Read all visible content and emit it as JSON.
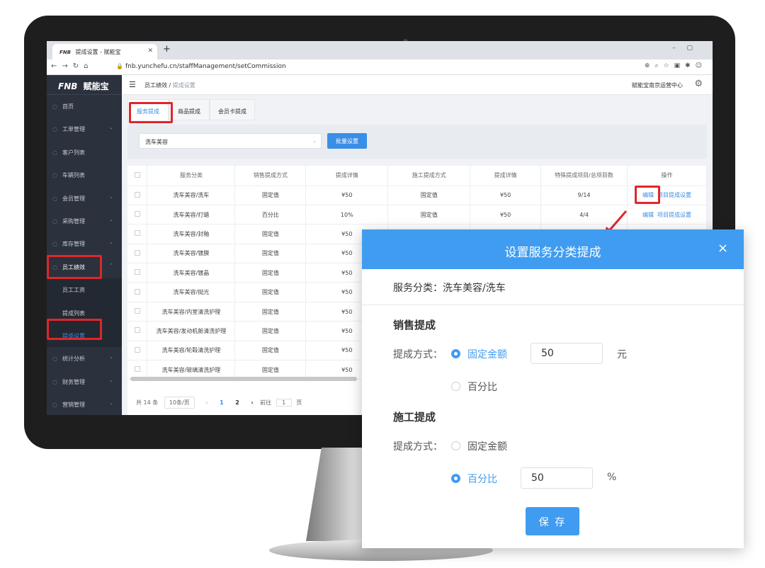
{
  "browser": {
    "tab_title": "提成设置 - 赋能宝",
    "tab_logo": "FNB",
    "url": "fnb.yunchefu.cn/staffManagement/setCommission"
  },
  "app": {
    "logo_text": "赋能宝",
    "logo_mark": "FNB",
    "store_name": "赋能宝南京运营中心"
  },
  "breadcrumb": {
    "parent": "员工绩效",
    "separator": "/",
    "current": "提成设置"
  },
  "sidebar": {
    "items": [
      {
        "label": "首页",
        "icon": "home-icon",
        "arrow": false
      },
      {
        "label": "工单管理",
        "icon": "order-icon",
        "arrow": true
      },
      {
        "label": "客户列表",
        "icon": "customer-icon",
        "arrow": false
      },
      {
        "label": "车辆列表",
        "icon": "car-icon",
        "arrow": false
      },
      {
        "label": "会员管理",
        "icon": "member-icon",
        "arrow": true
      },
      {
        "label": "采购管理",
        "icon": "cart-icon",
        "arrow": true
      },
      {
        "label": "库存管理",
        "icon": "stock-icon",
        "arrow": true
      },
      {
        "label": "员工绩效",
        "icon": "staff-icon",
        "arrow": true,
        "open": true
      },
      {
        "label": "员工工资",
        "sub": true
      },
      {
        "label": "提成列表",
        "sub": true
      },
      {
        "label": "提成设置",
        "sub": true,
        "active": true
      },
      {
        "label": "统计分析",
        "icon": "chart-icon",
        "arrow": true
      },
      {
        "label": "财务管理",
        "icon": "finance-icon",
        "arrow": true
      },
      {
        "label": "营销管理",
        "icon": "marketing-icon",
        "arrow": true
      }
    ]
  },
  "tabs": [
    "服务提成",
    "商品提成",
    "会员卡提成"
  ],
  "filter": {
    "selected": "洗车美容",
    "batch_button": "批量设置"
  },
  "table": {
    "headers": [
      "服务分类",
      "销售提成方式",
      "提成详情",
      "施工提成方式",
      "提成详情",
      "特殊提成项目/总项目数",
      "操作"
    ],
    "rows": [
      [
        "洗车美容/洗车",
        "固定值",
        "¥50",
        "固定值",
        "¥50",
        "9/14"
      ],
      [
        "洗车美容/打蜡",
        "百分比",
        "10%",
        "固定值",
        "¥50",
        "4/4"
      ],
      [
        "洗车美容/封釉",
        "固定值",
        "¥50",
        "",
        "",
        ""
      ],
      [
        "洗车美容/镀膜",
        "固定值",
        "¥50",
        "",
        "",
        ""
      ],
      [
        "洗车美容/镀晶",
        "固定值",
        "¥50",
        "",
        "",
        ""
      ],
      [
        "洗车美容/抛光",
        "固定值",
        "¥50",
        "",
        "",
        ""
      ],
      [
        "洗车美容/内室清洗护理",
        "固定值",
        "¥50",
        "",
        "",
        ""
      ],
      [
        "洗车美容/发动机舱清洗护理",
        "固定值",
        "¥50",
        "",
        "",
        ""
      ],
      [
        "洗车美容/轮毂清洗护理",
        "固定值",
        "¥50",
        "",
        "",
        ""
      ],
      [
        "洗车美容/玻璃清洗护理",
        "固定值",
        "¥50",
        "",
        "",
        ""
      ]
    ],
    "action_edit": "编辑",
    "action_project": "项目提成设置"
  },
  "pager": {
    "total": "共 14 条",
    "page_size": "10条/页",
    "prev": "‹",
    "pages": [
      "1",
      "2"
    ],
    "next": "›",
    "goto_label": "前往",
    "goto_value": "1",
    "page_unit": "页"
  },
  "modal": {
    "title": "设置服务分类提成",
    "close": "×",
    "category_label": "服务分类：",
    "category_value": "洗车美容/洗车",
    "sales": {
      "title": "销售提成",
      "method_label": "提成方式：",
      "fixed_label": "固定金额",
      "fixed_value": "50",
      "fixed_unit": "元",
      "percent_label": "百分比"
    },
    "construction": {
      "title": "施工提成",
      "method_label": "提成方式：",
      "fixed_label": "固定金额",
      "percent_label": "百分比",
      "percent_value": "50",
      "percent_unit": "%"
    },
    "save_button": "保 存"
  },
  "colors": {
    "primary": "#409cf0",
    "highlight": "#e0262a",
    "sidebar_bg": "#2b323d"
  }
}
